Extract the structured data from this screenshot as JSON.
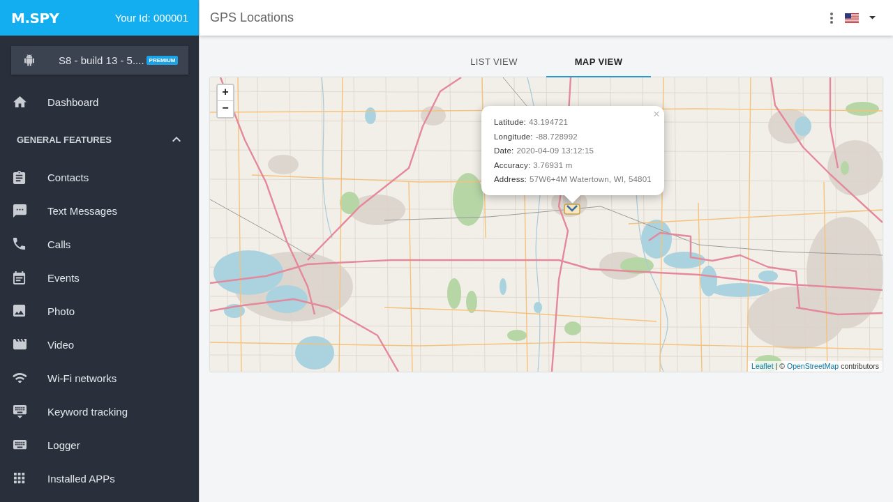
{
  "sidebar": {
    "logo": "M.SPY",
    "user_id": "Your Id: 000001",
    "device": {
      "name": "S8 - build 13 - 5....",
      "badge": "PREMIUM"
    },
    "items": [
      {
        "label": "Dashboard",
        "selected": false
      }
    ],
    "section": {
      "title": "GENERAL FEATURES",
      "expanded": true,
      "items": [
        {
          "label": "Contacts",
          "selected": false
        },
        {
          "label": "Text Messages",
          "selected": false
        },
        {
          "label": "Calls",
          "selected": false
        },
        {
          "label": "Events",
          "selected": false
        },
        {
          "label": "Photo",
          "selected": false
        },
        {
          "label": "Video",
          "selected": false
        },
        {
          "label": "Wi-Fi networks",
          "selected": false
        },
        {
          "label": "Keyword tracking",
          "selected": false
        },
        {
          "label": "Logger",
          "selected": false
        },
        {
          "label": "Installed APPs",
          "selected": false
        }
      ]
    }
  },
  "header": {
    "title": "GPS Locations"
  },
  "tabs": [
    {
      "label": "LIST VIEW",
      "selected": false
    },
    {
      "label": "MAP VIEW",
      "selected": true
    }
  ],
  "map": {
    "zoom_in": "+",
    "zoom_out": "−",
    "popup": {
      "close": "×",
      "fields": [
        {
          "label": "Latitude:",
          "value": "43.194721"
        },
        {
          "label": "Longitude:",
          "value": "-88.728992"
        },
        {
          "label": "Date:",
          "value": "2020-04-09 13:12:15"
        },
        {
          "label": "Accuracy:",
          "value": "3.76931 m"
        },
        {
          "label": "Address:",
          "value": "57W6+4M Watertown, WI, 54801"
        }
      ]
    },
    "attribution": {
      "parts": [
        {
          "text": "Leaflet",
          "link": true
        },
        {
          "text": "| ©",
          "link": false
        },
        {
          "text": "OpenStreetMap",
          "link": true
        },
        {
          "text": "contributors",
          "link": false
        }
      ]
    }
  }
}
